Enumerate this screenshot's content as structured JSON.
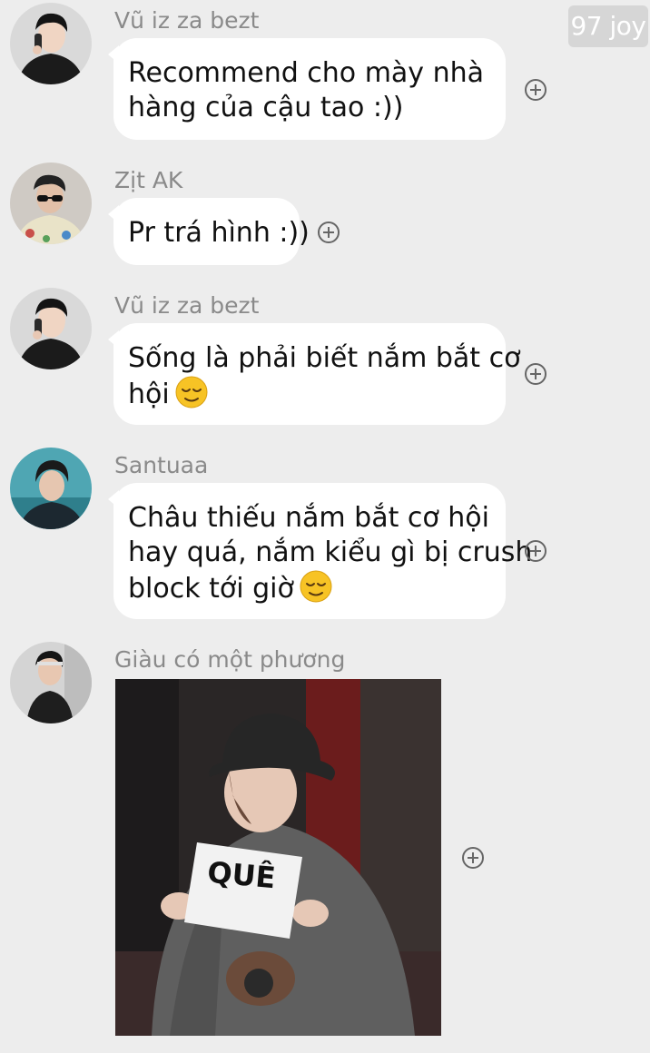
{
  "watermark": "97 joy",
  "messages": [
    {
      "sender": "Vũ iz za bezt",
      "lines": [
        "Recommend cho mày nhà",
        "hàng của cậu tao :))"
      ]
    },
    {
      "sender": "Zịt AK",
      "lines": [
        "Pr trá hình :))"
      ]
    },
    {
      "sender": "Vũ iz za bezt",
      "lines": [
        "Sống là phải biết nắm bắt cơ",
        "hội"
      ],
      "emoji": "relieved-face"
    },
    {
      "sender": "Santuaa",
      "lines": [
        "Châu thiếu nắm bắt cơ hội",
        "hay quá, nắm kiểu gì bị crush",
        "block tới giờ"
      ],
      "emoji": "relieved-face"
    },
    {
      "sender": "Giàu có một phương",
      "sticker_text": "QUÊ"
    }
  ],
  "icons": {
    "reaction": "add-reaction-icon",
    "emoji": "relieved-face-emoji"
  },
  "colors": {
    "background": "#ededed",
    "bubble": "#ffffff",
    "sender_name": "#8a8a8a",
    "text": "#111111"
  }
}
